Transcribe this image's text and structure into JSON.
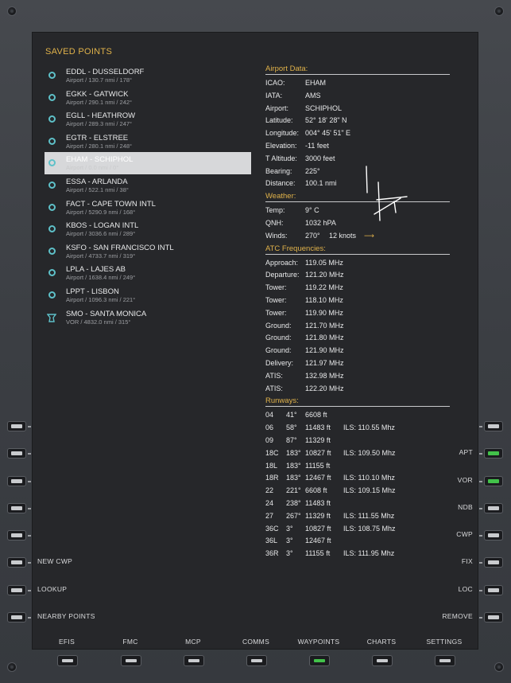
{
  "saved_points": {
    "title": "SAVED POINTS",
    "items": [
      {
        "name": "EDDL - DUSSELDORF",
        "sub": "Airport / 130.7 nmi / 178°",
        "icon": "airport-icon"
      },
      {
        "name": "EGKK - GATWICK",
        "sub": "Airport / 290.1 nmi / 242°",
        "icon": "airport-icon"
      },
      {
        "name": "EGLL - HEATHROW",
        "sub": "Airport / 289.3 nmi / 247°",
        "icon": "airport-icon"
      },
      {
        "name": "EGTR - ELSTREE",
        "sub": "Airport / 280.1 nmi / 248°",
        "icon": "airport-icon"
      },
      {
        "name": "EHAM - SCHIPHOL",
        "sub": "Airport / 0.0 nmi / 0°",
        "icon": "airport-icon",
        "selected": true
      },
      {
        "name": "ESSA - ARLANDA",
        "sub": "Airport / 522.1 nmi / 38°",
        "icon": "airport-icon"
      },
      {
        "name": "FACT - CAPE TOWN INTL",
        "sub": "Airport / 5290.9 nmi / 168°",
        "icon": "airport-icon"
      },
      {
        "name": "KBOS - LOGAN INTL",
        "sub": "Airport / 3036.6 nmi / 289°",
        "icon": "airport-icon"
      },
      {
        "name": "KSFO - SAN FRANCISCO INTL",
        "sub": "Airport / 4733.7 nmi / 319°",
        "icon": "airport-icon"
      },
      {
        "name": "LPLA - LAJES AB",
        "sub": "Airport / 1638.4 nmi / 249°",
        "icon": "airport-icon"
      },
      {
        "name": "LPPT - LISBON",
        "sub": "Airport / 1096.3 nmi / 221°",
        "icon": "airport-icon"
      },
      {
        "name": "SMO - SANTA MONICA",
        "sub": "VOR / 4832.0 nmi / 315°",
        "icon": "vor-icon"
      }
    ]
  },
  "airport_data": {
    "heading": "Airport Data:",
    "rows": [
      {
        "label": "ICAO:",
        "value": "EHAM"
      },
      {
        "label": "IATA:",
        "value": "AMS"
      },
      {
        "label": "Airport:",
        "value": "SCHIPHOL"
      },
      {
        "label": "Latitude:",
        "value": "52° 18' 28\" N"
      },
      {
        "label": "Longitude:",
        "value": "004° 45' 51\" E"
      },
      {
        "label": "Elevation:",
        "value": "-11 feet"
      },
      {
        "label": "T Altitude:",
        "value": "3000 feet"
      },
      {
        "label": "Bearing:",
        "value": "225°"
      },
      {
        "label": "Distance:",
        "value": "100.1 nmi"
      }
    ]
  },
  "weather": {
    "heading": "Weather:",
    "temp_label": "Temp:",
    "temp": "9° C",
    "qnh_label": "QNH:",
    "qnh": "1032 hPA",
    "winds_label": "Winds:",
    "winds_dir": "270°",
    "winds_speed": "12 knots",
    "winds_arrow": "⟶"
  },
  "atc": {
    "heading": "ATC Frequencies:",
    "rows": [
      {
        "label": "Approach:",
        "value": "119.05 MHz"
      },
      {
        "label": "Departure:",
        "value": "121.20 MHz"
      },
      {
        "label": "Tower:",
        "value": "119.22 MHz"
      },
      {
        "label": "Tower:",
        "value": "118.10 MHz"
      },
      {
        "label": "Tower:",
        "value": "119.90 MHz"
      },
      {
        "label": "Ground:",
        "value": "121.70 MHz"
      },
      {
        "label": "Ground:",
        "value": "121.80 MHz"
      },
      {
        "label": "Ground:",
        "value": "121.90 MHz"
      },
      {
        "label": "Delivery:",
        "value": "121.97 MHz"
      },
      {
        "label": "ATIS:",
        "value": "132.98 MHz"
      },
      {
        "label": "ATIS:",
        "value": "122.20 MHz"
      }
    ]
  },
  "runways": {
    "heading": "Runways:",
    "rows": [
      {
        "id": "04",
        "hdg": "41°",
        "len": "6608 ft",
        "ils": ""
      },
      {
        "id": "06",
        "hdg": "58°",
        "len": "11483 ft",
        "ils": "ILS: 110.55 Mhz"
      },
      {
        "id": "09",
        "hdg": "87°",
        "len": "11329 ft",
        "ils": ""
      },
      {
        "id": "18C",
        "hdg": "183°",
        "len": "10827 ft",
        "ils": "ILS: 109.50 Mhz"
      },
      {
        "id": "18L",
        "hdg": "183°",
        "len": "11155 ft",
        "ils": ""
      },
      {
        "id": "18R",
        "hdg": "183°",
        "len": "12467 ft",
        "ils": "ILS: 110.10 Mhz"
      },
      {
        "id": "22",
        "hdg": "221°",
        "len": "6608 ft",
        "ils": "ILS: 109.15 Mhz"
      },
      {
        "id": "24",
        "hdg": "238°",
        "len": "11483 ft",
        "ils": ""
      },
      {
        "id": "27",
        "hdg": "267°",
        "len": "11329 ft",
        "ils": "ILS: 111.55 Mhz"
      },
      {
        "id": "36C",
        "hdg": "3°",
        "len": "10827 ft",
        "ils": "ILS: 108.75 Mhz"
      },
      {
        "id": "36L",
        "hdg": "3°",
        "len": "12467 ft",
        "ils": ""
      },
      {
        "id": "36R",
        "hdg": "3°",
        "len": "11155 ft",
        "ils": "ILS: 111.95 Mhz"
      }
    ]
  },
  "left_buttons": [
    "",
    "",
    "",
    "",
    "",
    "NEW CWP",
    "LOOKUP",
    "NEARBY POINTS"
  ],
  "right_buttons": [
    {
      "label": "",
      "active": false
    },
    {
      "label": "APT",
      "active": true
    },
    {
      "label": "VOR",
      "active": true
    },
    {
      "label": "NDB",
      "active": false
    },
    {
      "label": "CWP",
      "active": false
    },
    {
      "label": "FIX",
      "active": false
    },
    {
      "label": "LOC",
      "active": false
    },
    {
      "label": "REMOVE",
      "active": false
    }
  ],
  "bottom_tabs": [
    {
      "label": "EFIS",
      "active": false
    },
    {
      "label": "FMC",
      "active": false
    },
    {
      "label": "MCP",
      "active": false
    },
    {
      "label": "COMMS",
      "active": false
    },
    {
      "label": "WAYPOINTS",
      "active": true
    },
    {
      "label": "CHARTS",
      "active": false
    },
    {
      "label": "SETTINGS",
      "active": false
    }
  ],
  "colors": {
    "accent": "#e0b24a",
    "icon": "#5ec1c9",
    "active_led": "#42c24a"
  }
}
